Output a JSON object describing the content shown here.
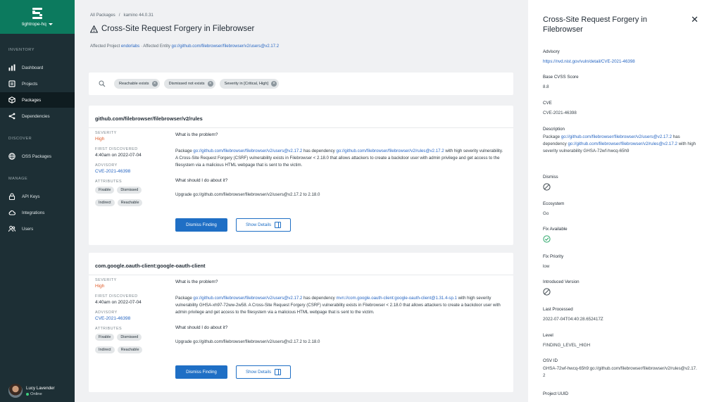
{
  "sidebar": {
    "org": "tightrope-hq",
    "sections": {
      "inventory": "INVENTORY",
      "discover": "DISCOVER",
      "manage": "MANAGE"
    },
    "items": [
      {
        "label": "Dashboard",
        "icon": "bar-chart-icon"
      },
      {
        "label": "Projects",
        "icon": "folder-icon"
      },
      {
        "label": "Packages",
        "icon": "package-icon",
        "active": true
      },
      {
        "label": "Dependencies",
        "icon": "share-icon"
      },
      {
        "label": "OSS Packages",
        "icon": "globe-icon"
      },
      {
        "label": "API Keys",
        "icon": "lock-icon"
      },
      {
        "label": "Integrations",
        "icon": "cloud-icon"
      },
      {
        "label": "Users",
        "icon": "users-icon"
      }
    ],
    "user": {
      "name": "Lucy Lavender",
      "status": "Online"
    }
  },
  "header": {
    "breadcrumb": [
      "All Packages",
      "/",
      "kamino 44.0.31"
    ],
    "title": "Cross-Site Request Forgery in Filebrowser",
    "affected_project_label": "Affected Project",
    "affected_project": "endorlabs",
    "separator": "·",
    "affected_entity_label": "Affected Entity",
    "affected_entity": "go://github.com/filebrowser/filebrowser/v2/users@v2.17.2"
  },
  "filters": [
    "Reachable exists",
    "Dismissed not exists",
    "Severity in [Critical, High]"
  ],
  "labels": {
    "severity": "SEVERITY",
    "first_discovered": "FIRST DISCOVERED",
    "advisory": "ADVISORY",
    "attributes": "ATTRIBUTES",
    "problem": "What is the problem?",
    "todo": "What should I do about it?",
    "dismiss": "Dismiss Finding",
    "show_details": "Show Details"
  },
  "findings": [
    {
      "title": "github.com/filebrowser/filebrowser/v2/rules",
      "severity": "High",
      "first_discovered": "4:40am on 2022-07-04",
      "advisory": "CVE-2021-46398",
      "attributes": [
        "Fixable",
        "Dismissed",
        "Indirect",
        "Reachable"
      ],
      "p_pre": "Package ",
      "p_link1": "go://github.com/filebrowser/filebrowser/v2/users@v2.17.2",
      "p_mid": " has dependency ",
      "p_link2": "go://github.com/filebrowser/filebrowser/v2/rules@v2.17.2",
      "p_post": " with high severity vulnerability. A Cross-Site Request Forgery (CSRF) vulnerability exists in Filebrowser < 2.18.0 that allows attackers to create a backdoor user with admin privilege and get access to the filesystem via a malicious HTML webpage that is sent to the victim.",
      "fix": "Upgrade go://github.com/filebrowser/filebrowser/v2/users@v2.17.2 to 2.18.0"
    },
    {
      "title": "com.google.oauth-client:google-oauth-client",
      "severity": "High",
      "first_discovered": "4:40am on 2022-07-04",
      "advisory": "CVE-2021-46398",
      "attributes": [
        "Fixable",
        "Dismissed",
        "Indirect",
        "Reachable"
      ],
      "p_pre": "Package ",
      "p_link1": "go://github.com/filebrowser/filebrowser/v2/users@v2.17.2",
      "p_mid": " has dependency ",
      "p_link2": "mvn://com.google.oauth-client:google-oauth-client@1.31.4-sp.1",
      "p_post": " with high severity vulnerability GHSA-xh97-72ww-2w58. A Cross-Site Request Forgery (CSRF) vulnerability exists in Filebrowser < 2.18.0 that allows attackers to create a backdoor user with admin privilege and get access to the filesystem via a malicious HTML webpage that is sent to the victim.",
      "fix": "Upgrade go://github.com/filebrowser/filebrowser/v2/users@v2.17.2 to 2.18.0"
    }
  ],
  "panel": {
    "title": "Cross-Site Request Forgery in Filebrowser",
    "advisory_label": "Advisory",
    "advisory": "https://nvd.nist.gov/vuln/detail/CVE-2021-46398",
    "cvss_label": "Base CVSS Score",
    "cvss": "8.8",
    "cve_label": "CVE",
    "cve": "CVE-2021-46398",
    "description_label": "Description",
    "desc_pre": "Package ",
    "desc_link1": "go://github.com/filebrowser/filebrowser/v2/users@v2.17.2",
    "desc_mid": " has dependency ",
    "desc_link2": "go://github.com/filebrowser/filebrowser/v2/rules@v2.17.2",
    "desc_post": " with high severity vulnerability GHSA-72wf-hwcq-65h9",
    "dismiss_label": "Dismiss",
    "ecosystem_label": "Ecosystem",
    "ecosystem": "Go",
    "fix_available_label": "Fix Available",
    "fix_priority_label": "Fix Priority",
    "fix_priority": "low",
    "introduced_label": "Introduced Version",
    "last_processed_label": "Last Processed",
    "last_processed": "2022-07-04T04:40:28.652417Z",
    "level_label": "Level",
    "level": "FINDING_LEVEL_HIGH",
    "osv_label": "OSV ID",
    "osv": "GHSA-72wf-hwcq-65h9:go://github.com/filebrowser/filebrowser/v2/rules@v2.17.2",
    "project_uuid_label": "Project UUID"
  },
  "colors": {
    "sidebar": "#1d2f35",
    "brand": "#0c7a5e",
    "primary": "#1f6fc5",
    "link": "#2766c2",
    "high": "#e05d2b",
    "success": "#2ea86b"
  }
}
